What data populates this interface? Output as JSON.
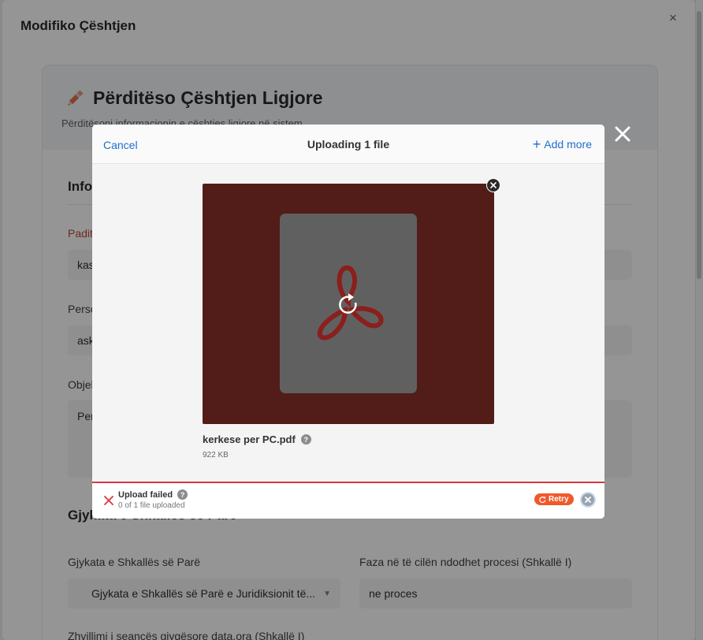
{
  "outer_modal": {
    "title": "Modifiko Çështjen",
    "close_label": "×"
  },
  "card": {
    "title": "Përditëso Çështjen Ligjore",
    "subtitle": "Përditësoni informacionin e çështjes ligjore në sistem",
    "section1_heading": "Info",
    "fields": [
      {
        "label": "Padite",
        "value": "kas"
      },
      {
        "label": "Perso",
        "value": "ask"
      },
      {
        "label": "Objek",
        "value": "Per"
      }
    ],
    "section2_heading": "Gjykata e Shkallës së Parë",
    "court_label": "Gjykata e Shkallës së Parë",
    "court_value": "Gjykata e Shkallës së Parë e Juridiksionit të...",
    "phase_label": "Faza në të cilën ndodhet procesi (Shkallë I)",
    "phase_value": "ne proces",
    "session_label": "Zhvillimi i seancës gjyqësore data,ora (Shkallë I)"
  },
  "upload_dialog": {
    "cancel_label": "Cancel",
    "title": "Uploading 1 file",
    "add_more_label": "Add more",
    "file": {
      "name": "kerkese per PC.pdf",
      "size": "922 KB",
      "help": "?"
    },
    "status": {
      "title": "Upload failed",
      "subtitle": "0 of 1 file uploaded",
      "help": "?",
      "retry_label": "Retry"
    }
  },
  "colors": {
    "link": "#1f6fd1",
    "preview_bg": "#521c19",
    "error": "#d9363e",
    "retry": "#f0592a"
  }
}
